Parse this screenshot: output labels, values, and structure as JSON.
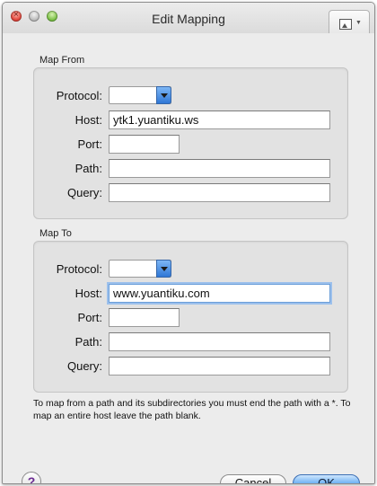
{
  "window": {
    "title": "Edit Mapping"
  },
  "toolbar": {
    "icon": "image-icon"
  },
  "map_from": {
    "section_label": "Map From",
    "protocol_label": "Protocol:",
    "protocol_value": "",
    "host_label": "Host:",
    "host_value": "ytk1.yuantiku.ws",
    "port_label": "Port:",
    "port_value": "",
    "path_label": "Path:",
    "path_value": "",
    "query_label": "Query:",
    "query_value": ""
  },
  "map_to": {
    "section_label": "Map To",
    "protocol_label": "Protocol:",
    "protocol_value": "",
    "host_label": "Host:",
    "host_value": "www.yuantiku.com",
    "port_label": "Port:",
    "port_value": "",
    "path_label": "Path:",
    "path_value": "",
    "query_label": "Query:",
    "query_value": ""
  },
  "help_text": "To map from a path and its subdirectories you must end the path with a *. To map an entire host leave the path blank.",
  "buttons": {
    "help": "?",
    "cancel": "Cancel",
    "ok": "OK"
  },
  "colors": {
    "accent": "#4c9aea",
    "focus_ring": "#9cc0ec"
  }
}
